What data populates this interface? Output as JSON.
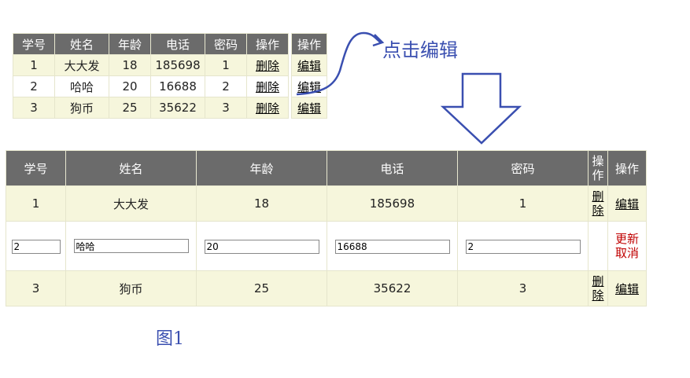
{
  "small_table": {
    "headers": [
      "学号",
      "姓名",
      "年龄",
      "电话",
      "密码",
      "操作"
    ],
    "op_header": "操作",
    "rows": [
      {
        "id": "1",
        "name": "大大发",
        "age": "18",
        "phone": "185698",
        "pwd": "1",
        "delete": "删除",
        "edit": "编辑"
      },
      {
        "id": "2",
        "name": "哈哈",
        "age": "20",
        "phone": "16688",
        "pwd": "2",
        "delete": "删除",
        "edit": "编辑"
      },
      {
        "id": "3",
        "name": "狗币",
        "age": "25",
        "phone": "35622",
        "pwd": "3",
        "delete": "删除",
        "edit": "编辑"
      }
    ]
  },
  "annotation": {
    "callout": "点击编辑",
    "caption": "图1"
  },
  "big_table": {
    "headers": [
      "学号",
      "姓名",
      "年龄",
      "电话",
      "密码",
      "操作",
      "操作"
    ],
    "rows": [
      {
        "id": "1",
        "name": "大大发",
        "age": "18",
        "phone": "185698",
        "pwd": "1",
        "delete": "删除",
        "edit": "编辑"
      },
      {
        "id": "2",
        "name": "哈哈",
        "age": "20",
        "phone": "16688",
        "pwd": "2",
        "update": "更新",
        "cancel": "取消"
      },
      {
        "id": "3",
        "name": "狗币",
        "age": "25",
        "phone": "35622",
        "pwd": "3",
        "delete": "删除",
        "edit": "编辑"
      }
    ]
  },
  "colors": {
    "header_bg": "#6b6b6b",
    "row_alt": "#f6f6dc",
    "annotation": "#3a4fb0",
    "action_red": "#c00000"
  }
}
